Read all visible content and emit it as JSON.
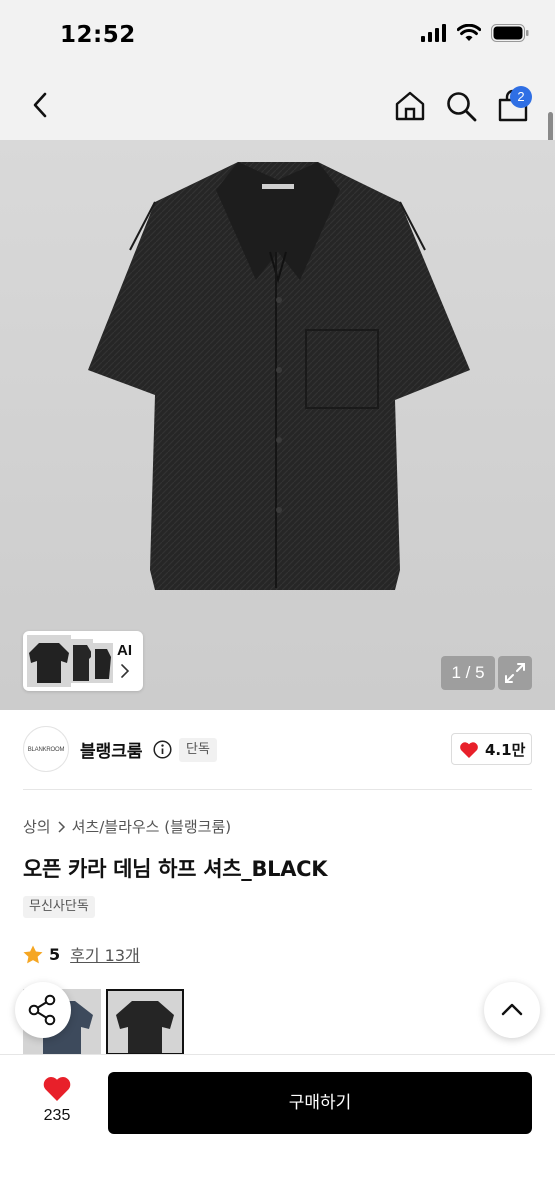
{
  "status_bar": {
    "time": "12:52"
  },
  "nav": {
    "cart_count": "2"
  },
  "hero": {
    "ai_label": "AI",
    "image_counter": "1 / 5"
  },
  "brand": {
    "logo_text": "BLANKROOM",
    "name": "블랭크룸",
    "exclusive_badge": "단독",
    "likes": "4.1만"
  },
  "product": {
    "breadcrumb": [
      "상의",
      "셔츠/블라우스 (블랭크룸)"
    ],
    "title": "오픈 카라 데님 하프 셔츠_BLACK",
    "store_badge": "무신사단독",
    "rating": "5",
    "reviews": "후기 13개"
  },
  "bottom_bar": {
    "wish_count": "235",
    "buy_label": "구매하기"
  },
  "colors": {
    "accent_red": "#e8202a",
    "badge_blue": "#2f6fe4",
    "button_black": "#000000",
    "star_yellow": "#f5a623"
  }
}
